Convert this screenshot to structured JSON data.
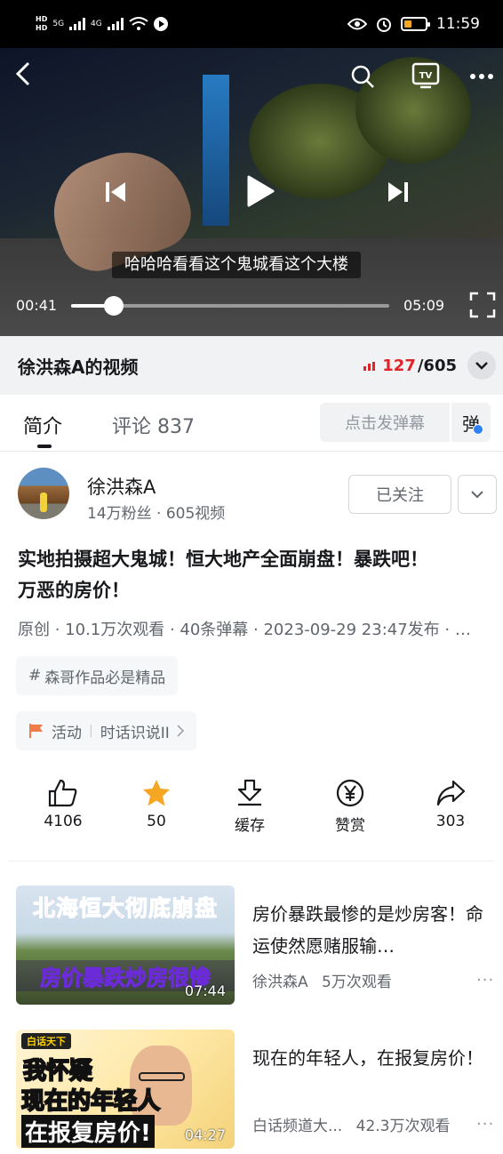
{
  "status_bar": {
    "time": "11:59",
    "hd1": "HD",
    "hd2": "HD",
    "net1": "5G",
    "net2": "4G"
  },
  "player": {
    "subtitle": "哈哈哈看看这个鬼城看这个大楼",
    "current_time": "00:41",
    "duration": "05:09",
    "progress": 0.133
  },
  "header": {
    "title": "徐洪森A的视频",
    "current_count": "127",
    "total_count": "/605"
  },
  "tabs": {
    "intro": "简介",
    "comments": "评论 837",
    "danmaku_placeholder": "点击发弹幕",
    "danmaku_toggle": "弹"
  },
  "uploader": {
    "name": "徐洪森A",
    "meta": "14万粉丝 · 605视频",
    "follow_label": "已关注"
  },
  "video": {
    "title": "实地拍摄超大鬼城！恒大地产全面崩盘！暴跌吧！万恶的房价！",
    "meta": "原创 · 10.1万次观看 · 40条弹幕 · 2023-09-29 23:47发布 · …",
    "tag": "森哥作品必是精品",
    "activity_label": "活动",
    "activity_name": "时话识说II"
  },
  "actions": {
    "like": "4106",
    "coin": "50",
    "cache": "缓存",
    "reward": "赞赏",
    "share": "303"
  },
  "recommended": [
    {
      "title": "房价暴跌最惨的是炒房客！命运使然愿赌服输…",
      "author": "徐洪森A",
      "views": "5万次观看",
      "duration": "07:44",
      "thumb_line1": "北海恒大彻底崩盘",
      "thumb_line2": "房价暴跌炒房很惨"
    },
    {
      "title": "现在的年轻人，在报复房价！",
      "author": "白话频道大...",
      "views": "42.3万次观看",
      "duration": "04:27",
      "thumb_brand": "白话天下",
      "thumb_line1": "我怀疑",
      "thumb_line2": "现在的年轻人",
      "thumb_line3": "在报复房价!"
    }
  ],
  "colors": {
    "accent_red": "#e0242a",
    "star": "#f5a623",
    "flag": "#f27b4a"
  }
}
